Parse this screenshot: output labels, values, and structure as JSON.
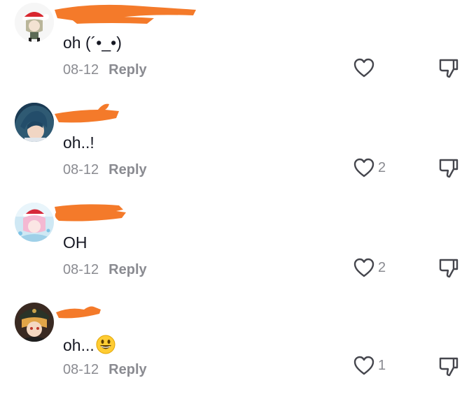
{
  "comments": [
    {
      "text": "oh (´•_•)",
      "date": "08-12",
      "reply_label": "Reply",
      "like_count": ""
    },
    {
      "text": "oh..!",
      "date": "08-12",
      "reply_label": "Reply",
      "like_count": "2"
    },
    {
      "text": "OH",
      "date": "08-12",
      "reply_label": "Reply",
      "like_count": "2"
    },
    {
      "text": "oh...",
      "date": "08-12",
      "reply_label": "Reply",
      "like_count": "1"
    }
  ],
  "icons": {
    "like": "heart-outline-icon",
    "dislike": "thumbs-down-outline-icon",
    "emoji": "grinning-face-emoji"
  },
  "colors": {
    "redaction": "#f47a2a",
    "text": "#161823",
    "meta": "#8a8b91"
  }
}
